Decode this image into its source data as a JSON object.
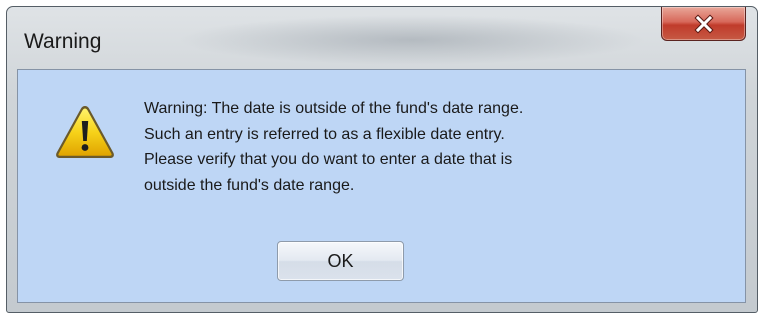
{
  "window": {
    "title": "Warning"
  },
  "title_bar": {
    "close_icon": "close-icon"
  },
  "dialog": {
    "icon": "warning-icon",
    "message_lines": [
      "Warning: The date is outside of the fund's date range.",
      "Such an entry is referred to as a flexible date entry.",
      "Please verify that you do want to enter a date that is",
      "outside the fund's date range."
    ],
    "ok_label": "OK"
  },
  "colors": {
    "content_background": "#bed6f5",
    "close_button": "#c7402f",
    "warning_yellow": "#f5c400"
  }
}
